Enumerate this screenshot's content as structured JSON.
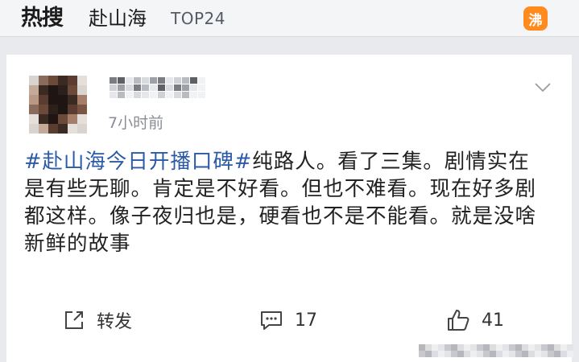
{
  "topbar": {
    "logo": "热搜",
    "title": "赴山海",
    "rank": "TOP24",
    "badge": "沸"
  },
  "post": {
    "time": "7小时前",
    "hashtag": "#赴山海今日开播口碑#",
    "body": "纯路人。看了三集。剧情实在是有些无聊。肯定是不好看。但也不难看。现在好多剧都这样。像子夜归也是，硬看也不是不能看。就是没啥新鲜的故事"
  },
  "actions": {
    "repost_label": "转发",
    "comment_count": "17",
    "like_count": "41"
  },
  "colors": {
    "hashtag": "#2b5aa6",
    "badge": "#ff8a1e",
    "logo_spark": "#ff5a1f"
  },
  "icons": {
    "repost": "share-square-icon",
    "comment": "comment-icon",
    "like": "thumbs-up-icon",
    "more": "chevron-down-icon"
  }
}
